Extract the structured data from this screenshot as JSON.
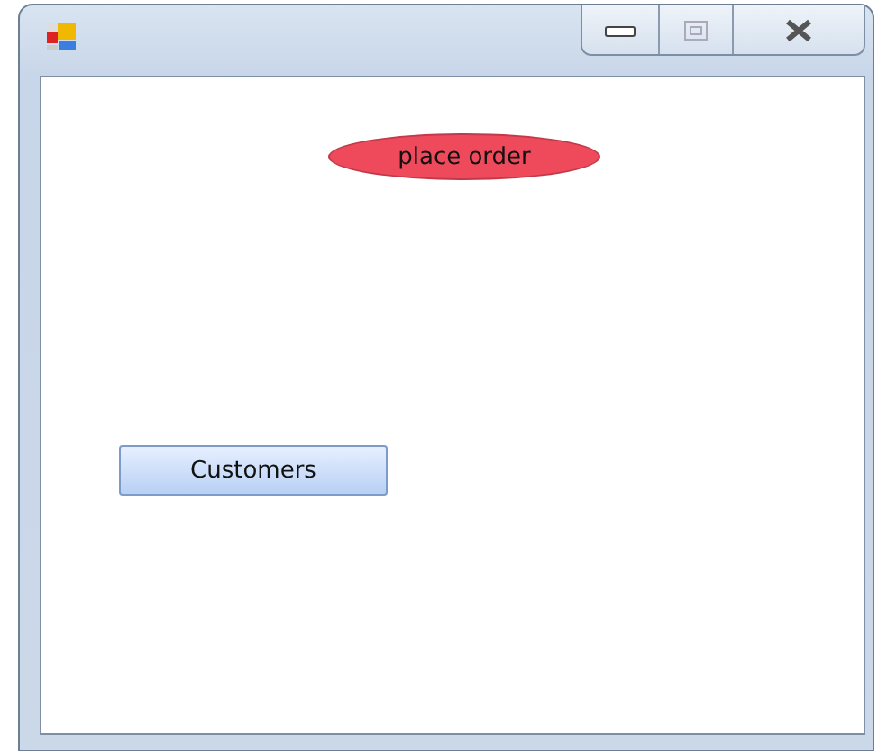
{
  "form": {
    "buttons": [
      {
        "kind": "ellipse",
        "label": "place order"
      },
      {
        "kind": "standard",
        "label": "Customers"
      }
    ]
  }
}
